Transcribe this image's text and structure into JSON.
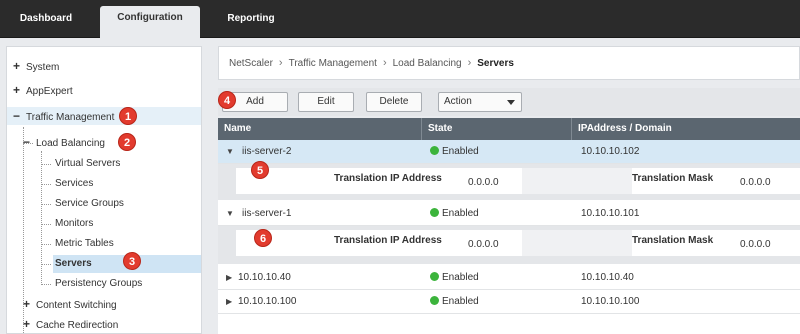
{
  "topnav": {
    "tabs": [
      {
        "label": "Dashboard"
      },
      {
        "label": "Configuration"
      },
      {
        "label": "Reporting"
      }
    ]
  },
  "sidebar": {
    "items": [
      {
        "label": "System",
        "toggle": "+"
      },
      {
        "label": "AppExpert",
        "toggle": "+"
      },
      {
        "label": "Traffic Management",
        "toggle": "−"
      },
      {
        "label": "Load Balancing",
        "toggle": "−"
      },
      {
        "label": "Virtual Servers"
      },
      {
        "label": "Services"
      },
      {
        "label": "Service Groups"
      },
      {
        "label": "Monitors"
      },
      {
        "label": "Metric Tables"
      },
      {
        "label": "Servers"
      },
      {
        "label": "Persistency Groups"
      },
      {
        "label": "Content Switching",
        "toggle": "+"
      },
      {
        "label": "Cache Redirection",
        "toggle": "+"
      }
    ]
  },
  "breadcrumb": {
    "items": [
      "NetScaler",
      "Traffic Management",
      "Load Balancing"
    ],
    "current": "Servers",
    "separator": "›"
  },
  "toolbar": {
    "add_label": "Add",
    "edit_label": "Edit",
    "delete_label": "Delete",
    "action_label": "Action"
  },
  "table": {
    "columns": [
      "Name",
      "State",
      "IPAddress / Domain"
    ],
    "rows": [
      {
        "name": "iis-server-2",
        "state": "Enabled",
        "ip": "10.10.10.102",
        "expanded": true
      },
      {
        "name": "iis-server-1",
        "state": "Enabled",
        "ip": "10.10.10.101",
        "expanded": true
      },
      {
        "name": "10.10.10.40",
        "state": "Enabled",
        "ip": "10.10.10.40",
        "expanded": false
      },
      {
        "name": "10.10.10.100",
        "state": "Enabled",
        "ip": "10.10.10.100",
        "expanded": false
      }
    ],
    "details": [
      {
        "tip_label": "Translation IP Address",
        "tip_value": "0.0.0.0",
        "mask_label": "Translation Mask",
        "mask_value": "0.0.0.0"
      },
      {
        "tip_label": "Translation IP Address",
        "tip_value": "0.0.0.0",
        "mask_label": "Translation Mask",
        "mask_value": "0.0.0.0"
      }
    ]
  },
  "markers": [
    "1",
    "2",
    "3",
    "4",
    "5",
    "6"
  ],
  "colors": {
    "topbar": "#2b2b2b",
    "marker": "#e23b2e",
    "header": "#5b6670",
    "selected_row": "#d6e8f5",
    "status_enabled": "#3cb43c"
  }
}
